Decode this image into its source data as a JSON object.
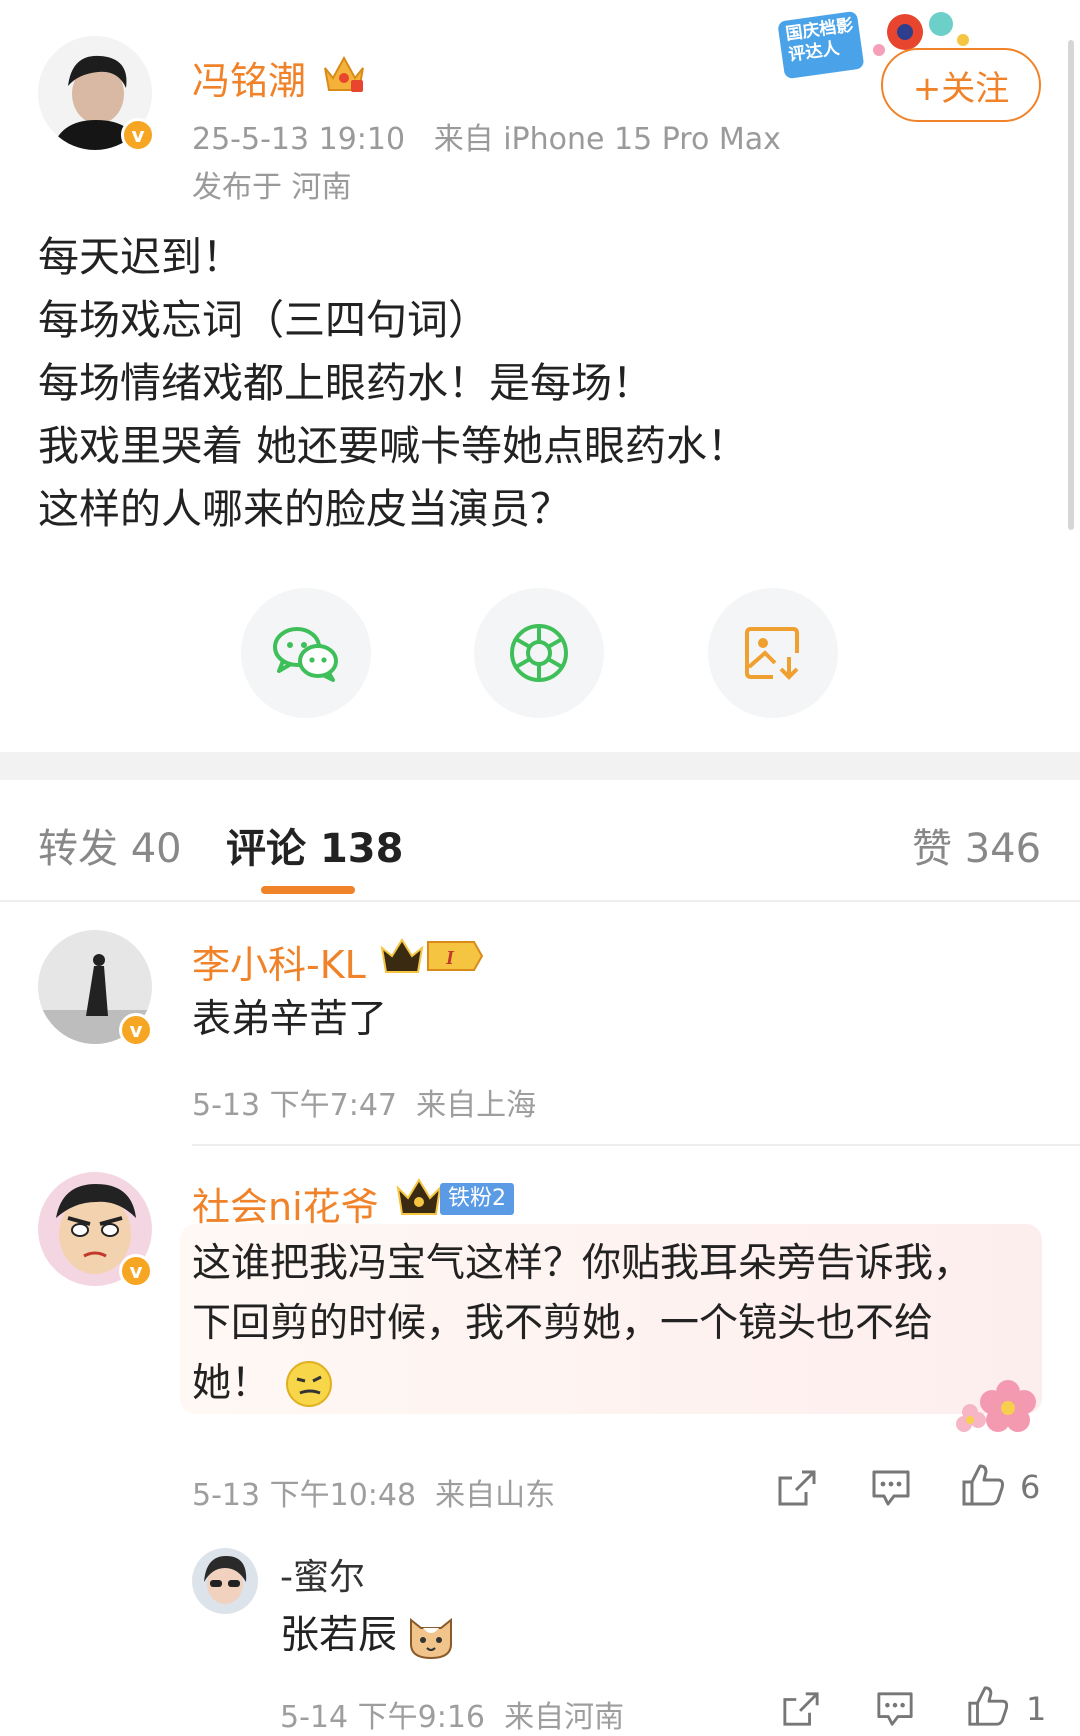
{
  "post": {
    "author": "冯铭潮",
    "timestamp": "25-5-13 19:10",
    "source": "来自 iPhone 15 Pro Max",
    "location": "发布于 河南",
    "follow_label": "+关注",
    "event_badge": "国庆档影评达人",
    "lines": [
      "每天迟到！",
      "每场戏忘词（三四句词）",
      "每场情绪戏都上眼药水！是每场！",
      "我戏里哭着 她还要喊卡等她点眼药水！",
      "这样的人哪来的脸皮当演员？"
    ]
  },
  "share_buttons": [
    {
      "icon": "wechat-icon"
    },
    {
      "icon": "moments-icon"
    },
    {
      "icon": "save-image-icon"
    }
  ],
  "tabs": {
    "repost": {
      "label": "转发",
      "count": "40"
    },
    "comment": {
      "label": "评论",
      "count": "138"
    },
    "like": {
      "label": "赞",
      "count": "346"
    }
  },
  "comments": [
    {
      "user": "李小科-KL",
      "badge": "I",
      "text": "表弟辛苦了",
      "time": "5-13 下午7:47",
      "from": "来自上海"
    },
    {
      "user": "社会ni花爷",
      "badge": "铁粉2",
      "text_lines": [
        "这谁把我冯宝气这样？你贴我耳朵旁告诉我，",
        "下回剪的时候，我不剪她，一个镜头也不给",
        "她！"
      ],
      "time": "5-13 下午10:48",
      "from": "来自山东",
      "likes": "6"
    }
  ],
  "reply": {
    "user": "-蜜尔",
    "text": "张若辰",
    "time": "5-14 下午9:16",
    "from": "来自河南",
    "likes": "1"
  },
  "colors": {
    "accent": "#f0832a",
    "meta_text": "#9a9a9a",
    "wechat_green": "#3fbf5a",
    "fan_badge": "#5b9be6"
  }
}
